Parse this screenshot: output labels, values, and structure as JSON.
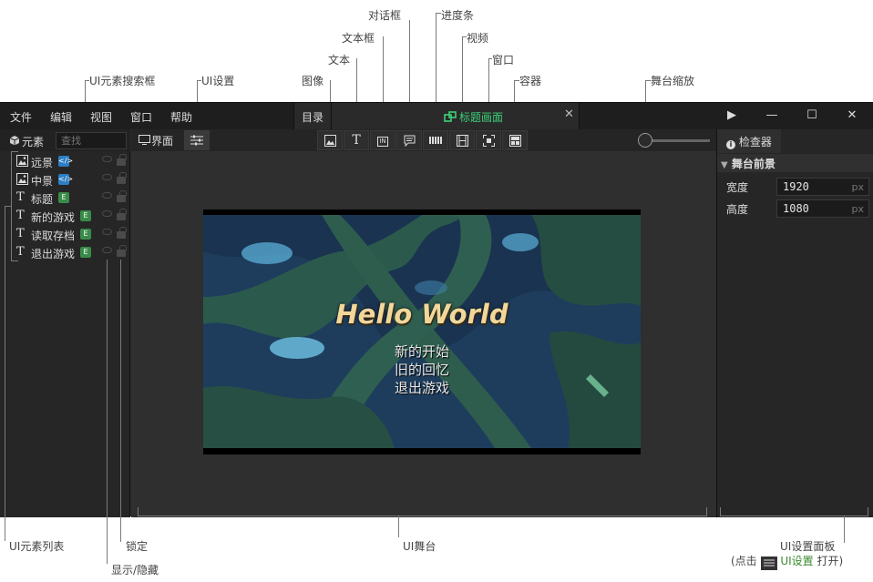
{
  "annotations": {
    "dialog": "对话框",
    "progress_bar": "进度条",
    "textbox": "文本框",
    "video": "视频",
    "text": "文本",
    "window": "窗口",
    "image": "图像",
    "container": "容器",
    "ui_search": "UI元素搜索框",
    "ui_settings": "UI设置",
    "stage_zoom": "舞台缩放",
    "element_list": "UI元素列表",
    "lock": "锁定",
    "show_hide": "显示/隐藏",
    "ui_stage": "UI舞台",
    "settings_panel": "UI设置面板",
    "settings_hint_prefix": "(点击",
    "settings_hint_link": "UI设置",
    "settings_hint_suffix": "打开)"
  },
  "menubar": {
    "items": [
      "文件",
      "编辑",
      "视图",
      "窗口",
      "帮助"
    ],
    "dir_tab": "目录",
    "active_tab": "标题画面",
    "close": "✕",
    "play": "▶",
    "minimize": "—",
    "maximize": "☐",
    "close_window": "✕"
  },
  "left_panel": {
    "title": "元素",
    "search_placeholder": "查找",
    "elements": [
      {
        "label": "远景",
        "type": "image",
        "badge": "</>"
      },
      {
        "label": "中景",
        "type": "image",
        "badge": "</>"
      },
      {
        "label": "标题",
        "type": "text",
        "badge": "E"
      },
      {
        "label": "新的游戏",
        "type": "text",
        "badge": "E"
      },
      {
        "label": "读取存档",
        "type": "text",
        "badge": "E"
      },
      {
        "label": "退出游戏",
        "type": "text",
        "badge": "E"
      }
    ]
  },
  "toolbar": {
    "interface_label": "界面",
    "tools": [
      "image",
      "text",
      "textbox",
      "dialog",
      "progress",
      "video",
      "window",
      "container"
    ],
    "text_glyph": "T",
    "textbox_glyph": "IN"
  },
  "stage": {
    "title": "Hello World",
    "menu": [
      "新的开始",
      "旧的回忆",
      "退出游戏"
    ]
  },
  "inspector": {
    "tab": "检查器",
    "section": "舞台前景",
    "props": [
      {
        "label": "宽度",
        "value": "1920",
        "unit": "px"
      },
      {
        "label": "高度",
        "value": "1080",
        "unit": "px"
      }
    ]
  },
  "colors": {
    "accent_green": "#3dcf78",
    "code_badge": "#2c7fc4",
    "e_badge": "#3a8a4a"
  }
}
